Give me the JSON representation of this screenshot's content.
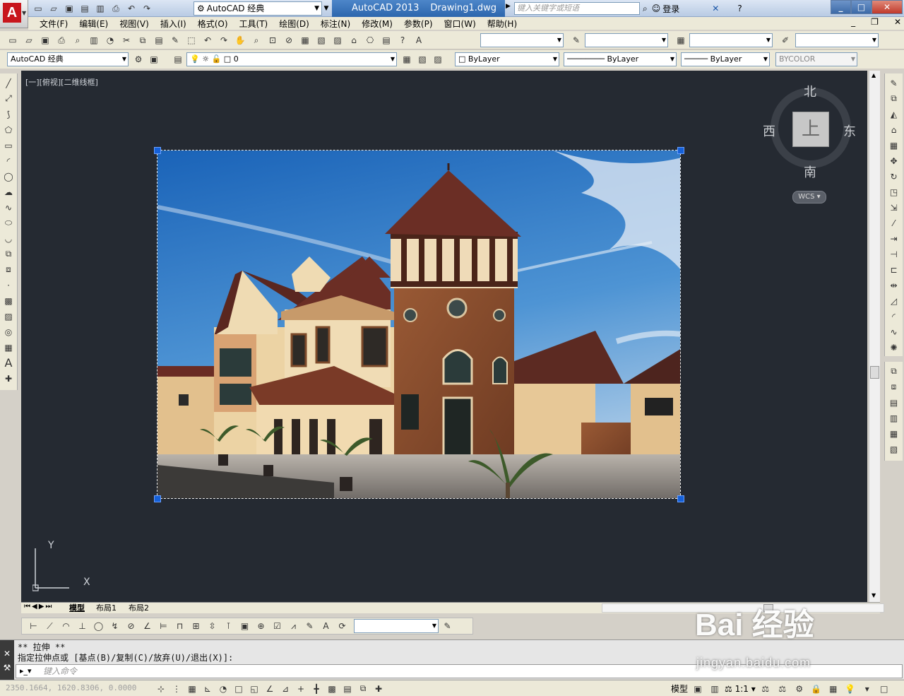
{
  "app": {
    "logo_letter": "A",
    "workspace": "AutoCAD 经典",
    "product": "AutoCAD 2013",
    "document": "Drawing1.dwg",
    "search_placeholder": "键入关键字或短语",
    "login": "登录"
  },
  "menu": [
    "文件(F)",
    "编辑(E)",
    "视图(V)",
    "插入(I)",
    "格式(O)",
    "工具(T)",
    "绘图(D)",
    "标注(N)",
    "修改(M)",
    "参数(P)",
    "窗口(W)",
    "帮助(H)"
  ],
  "toolbar2": {
    "workspace": "AutoCAD 经典",
    "layer": "0",
    "color": "ByLayer",
    "linetype": "ByLayer",
    "lineweight": "ByLayer",
    "plotstyle": "BYCOLOR"
  },
  "viewport": {
    "label": "[一][俯视][二维线框]",
    "viewcube": {
      "top": "上",
      "north": "北",
      "south": "南",
      "east": "东",
      "west": "西"
    },
    "wcs": "WCS",
    "ucs_y": "Y",
    "ucs_x": "X"
  },
  "tabs": [
    "模型",
    "布局1",
    "布局2"
  ],
  "command": {
    "line1": "** 拉伸 **",
    "line2": "指定拉伸点或 [基点(B)/复制(C)/放弃(U)/退出(X)]:",
    "input_placeholder": "键入命令"
  },
  "status": {
    "coords": "2350.1664, 1620.8306, 0.0000",
    "model": "模型",
    "scale": "1:1"
  },
  "watermark": {
    "main": "Bai  经验",
    "sub": "jingyan.baidu.com"
  },
  "colors": {
    "canvas": "#252a32",
    "grip": "#1560d8",
    "title_accent": "#2c66ad",
    "logo": "#c8161d"
  }
}
